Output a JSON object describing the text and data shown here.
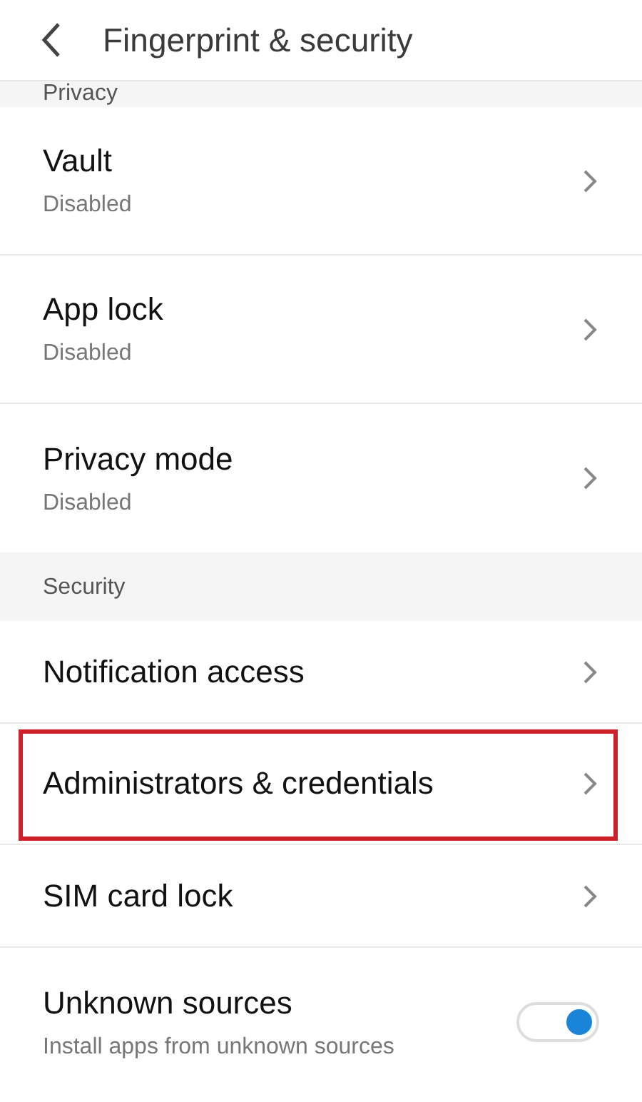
{
  "header": {
    "title": "Fingerprint & security"
  },
  "sections": [
    {
      "title": "Privacy",
      "items": [
        {
          "kind": "link",
          "title": "Vault",
          "subtitle": "Disabled",
          "highlighted": false
        },
        {
          "kind": "link",
          "title": "App lock",
          "subtitle": "Disabled",
          "highlighted": false
        },
        {
          "kind": "link",
          "title": "Privacy mode",
          "subtitle": "Disabled",
          "highlighted": false
        }
      ]
    },
    {
      "title": "Security",
      "items": [
        {
          "kind": "link",
          "title": "Notification access",
          "highlighted": false
        },
        {
          "kind": "link",
          "title": "Administrators & credentials",
          "highlighted": true
        },
        {
          "kind": "link",
          "title": "SIM card lock",
          "highlighted": false
        },
        {
          "kind": "toggle",
          "title": "Unknown sources",
          "subtitle": "Install apps from unknown sources",
          "on": true,
          "highlighted": false
        }
      ]
    }
  ]
}
